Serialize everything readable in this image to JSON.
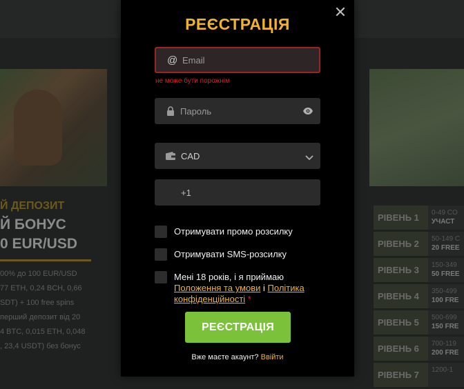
{
  "background": {
    "promo": {
      "line1": "Й ДЕПОЗИТ",
      "line2": "Й БОНУС",
      "line3": "0 EUR/USD",
      "desc_lines": [
        "00% до 100 EUR/USD",
        "77 ETH, 0,24 BCH, 0,66",
        "SDT) + 100 free spins",
        "перший депозит від 20",
        "4 BTC, 0,015 ETH, 0,048",
        ", 23,4 USDT) без бонус"
      ]
    },
    "levels": [
      {
        "name": "РІВЕНЬ 1",
        "range": "0-49 CO",
        "reward": "УЧАСТ"
      },
      {
        "name": "РІВЕНЬ 2",
        "range": "50-149 C",
        "reward": "20 FREE"
      },
      {
        "name": "РІВЕНЬ 3",
        "range": "150-349",
        "reward": "50 FREE"
      },
      {
        "name": "РІВЕНЬ 4",
        "range": "350-499",
        "reward": "100 FRE"
      },
      {
        "name": "РІВЕНЬ 5",
        "range": "500-699",
        "reward": "150 FRE"
      },
      {
        "name": "РІВЕНЬ 6",
        "range": "700-119",
        "reward": "200 FRE"
      },
      {
        "name": "РІВЕНЬ 7",
        "range": "1200-1",
        "reward": ""
      }
    ]
  },
  "modal": {
    "title": "РЕЄСТРАЦІЯ",
    "close_symbol": "✕",
    "email": {
      "placeholder": "Email",
      "value": "",
      "icon": "at-icon",
      "error": "не може бути порожнім"
    },
    "password": {
      "placeholder": "Пароль",
      "value": "",
      "icon": "lock-icon"
    },
    "currency": {
      "selected": "CAD",
      "icon": "wallet-icon"
    },
    "phone": {
      "prefix": "+1"
    },
    "checkboxes": {
      "promo": "Отримувати промо розсилку",
      "sms": "Отримувати SMS-розсилку",
      "terms_prefix": "Мені 18 років, і я приймаю",
      "terms_link": "Положення та умови",
      "terms_and": "і",
      "privacy_link": "Політика конфіденційності",
      "required_mark": "*"
    },
    "submit_label": "РЕЄСТРАЦІЯ",
    "login_prompt": "Вже маєте акаунт?",
    "login_link": "Ввійти"
  },
  "colors": {
    "accent": "#f0b429",
    "button": "#7bc23a",
    "error": "#e02020"
  }
}
